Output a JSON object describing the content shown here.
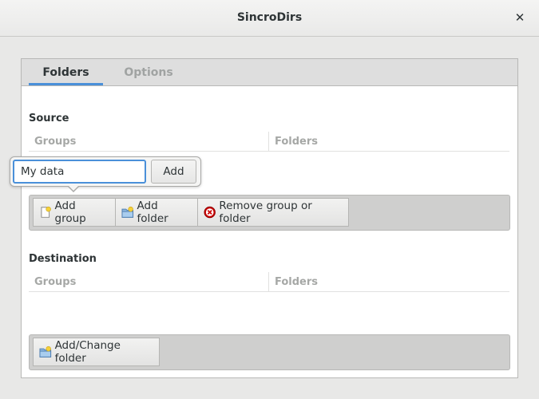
{
  "window": {
    "title": "SincroDirs",
    "close_icon": "close-icon"
  },
  "tabs": [
    {
      "label": "Folders",
      "active": true
    },
    {
      "label": "Options",
      "active": false
    }
  ],
  "source": {
    "label": "Source",
    "columns": {
      "groups": "Groups",
      "folders": "Folders"
    },
    "toolbar": {
      "add_group": "Add group",
      "add_folder": "Add folder",
      "remove": "Remove group or folder"
    }
  },
  "popover": {
    "input_value": "My data",
    "add_label": "Add"
  },
  "destination": {
    "label": "Destination",
    "columns": {
      "groups": "Groups",
      "folders": "Folders"
    },
    "toolbar": {
      "add_change_folder": "Add/Change folder"
    }
  },
  "colors": {
    "accent": "#4a90d9",
    "remove_icon": "#cc0000"
  }
}
